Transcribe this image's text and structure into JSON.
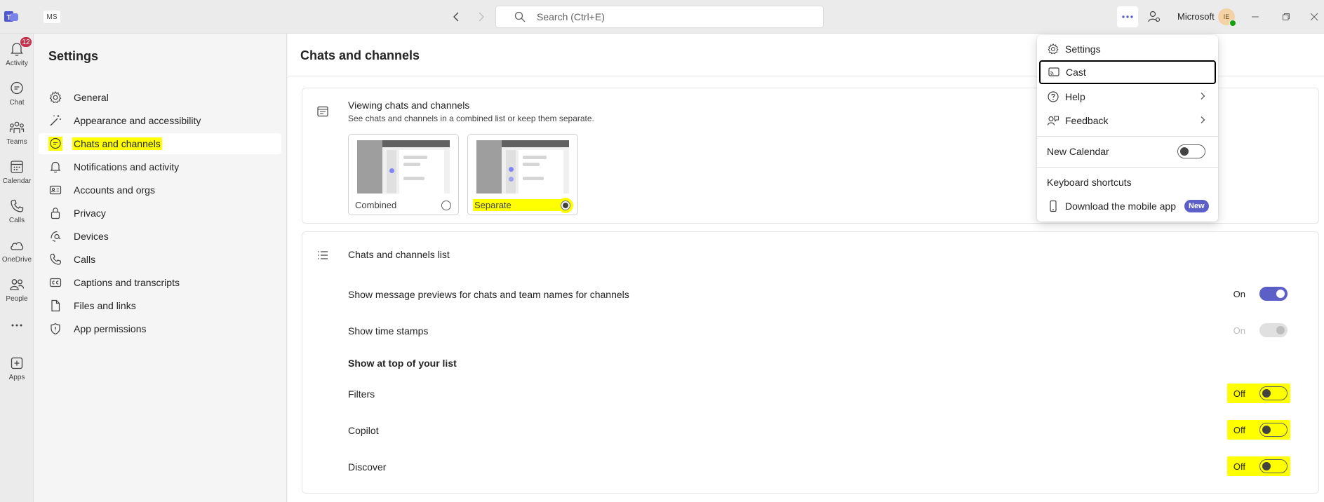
{
  "titlebar": {
    "org_initials": "MS",
    "search_placeholder": "Search (Ctrl+E)",
    "tenant": "Microsoft",
    "avatar_initials": "IE"
  },
  "rail": {
    "items": [
      {
        "label": "Activity",
        "icon": "bell-icon",
        "badge": "12"
      },
      {
        "label": "Chat",
        "icon": "chat-icon"
      },
      {
        "label": "Teams",
        "icon": "teams-icon"
      },
      {
        "label": "Calendar",
        "icon": "calendar-icon"
      },
      {
        "label": "Calls",
        "icon": "phone-icon"
      },
      {
        "label": "OneDrive",
        "icon": "cloud-icon"
      },
      {
        "label": "People",
        "icon": "people-icon"
      },
      {
        "label": "Apps",
        "icon": "apps-plus-icon"
      }
    ]
  },
  "settings_nav": {
    "title": "Settings",
    "items": [
      {
        "label": "General",
        "icon": "gear-icon"
      },
      {
        "label": "Appearance and accessibility",
        "icon": "wand-icon"
      },
      {
        "label": "Chats and channels",
        "icon": "chat-bubble-icon",
        "selected": true
      },
      {
        "label": "Notifications and activity",
        "icon": "bell-icon"
      },
      {
        "label": "Accounts and orgs",
        "icon": "id-card-icon"
      },
      {
        "label": "Privacy",
        "icon": "lock-icon"
      },
      {
        "label": "Devices",
        "icon": "devices-icon"
      },
      {
        "label": "Calls",
        "icon": "phone-icon"
      },
      {
        "label": "Captions and transcripts",
        "icon": "cc-icon"
      },
      {
        "label": "Files and links",
        "icon": "file-icon"
      },
      {
        "label": "App permissions",
        "icon": "shield-icon"
      }
    ]
  },
  "main": {
    "title": "Chats and channels",
    "viewing": {
      "title": "Viewing chats and channels",
      "subtitle": "See chats and channels in a combined list or keep them separate.",
      "options": [
        {
          "label": "Combined",
          "checked": false
        },
        {
          "label": "Separate",
          "checked": true
        }
      ]
    },
    "list": {
      "title": "Chats and channels list",
      "rows": [
        {
          "label": "Show message previews for chats and team names for channels",
          "state": "On"
        },
        {
          "label": "Show time stamps",
          "state": "On"
        }
      ],
      "heading": "Show at top of your list",
      "top_rows": [
        {
          "label": "Filters",
          "state": "Off"
        },
        {
          "label": "Copilot",
          "state": "Off"
        },
        {
          "label": "Discover",
          "state": "Off"
        }
      ]
    }
  },
  "menu": {
    "settings": "Settings",
    "cast": "Cast",
    "help": "Help",
    "feedback": "Feedback",
    "new_calendar": "New Calendar",
    "keyboard_shortcuts": "Keyboard shortcuts",
    "download_app": "Download the mobile app",
    "new_badge": "New"
  },
  "colors": {
    "accent": "#5b5fc7",
    "highlight": "#ffff00",
    "badge": "#c4314b"
  }
}
